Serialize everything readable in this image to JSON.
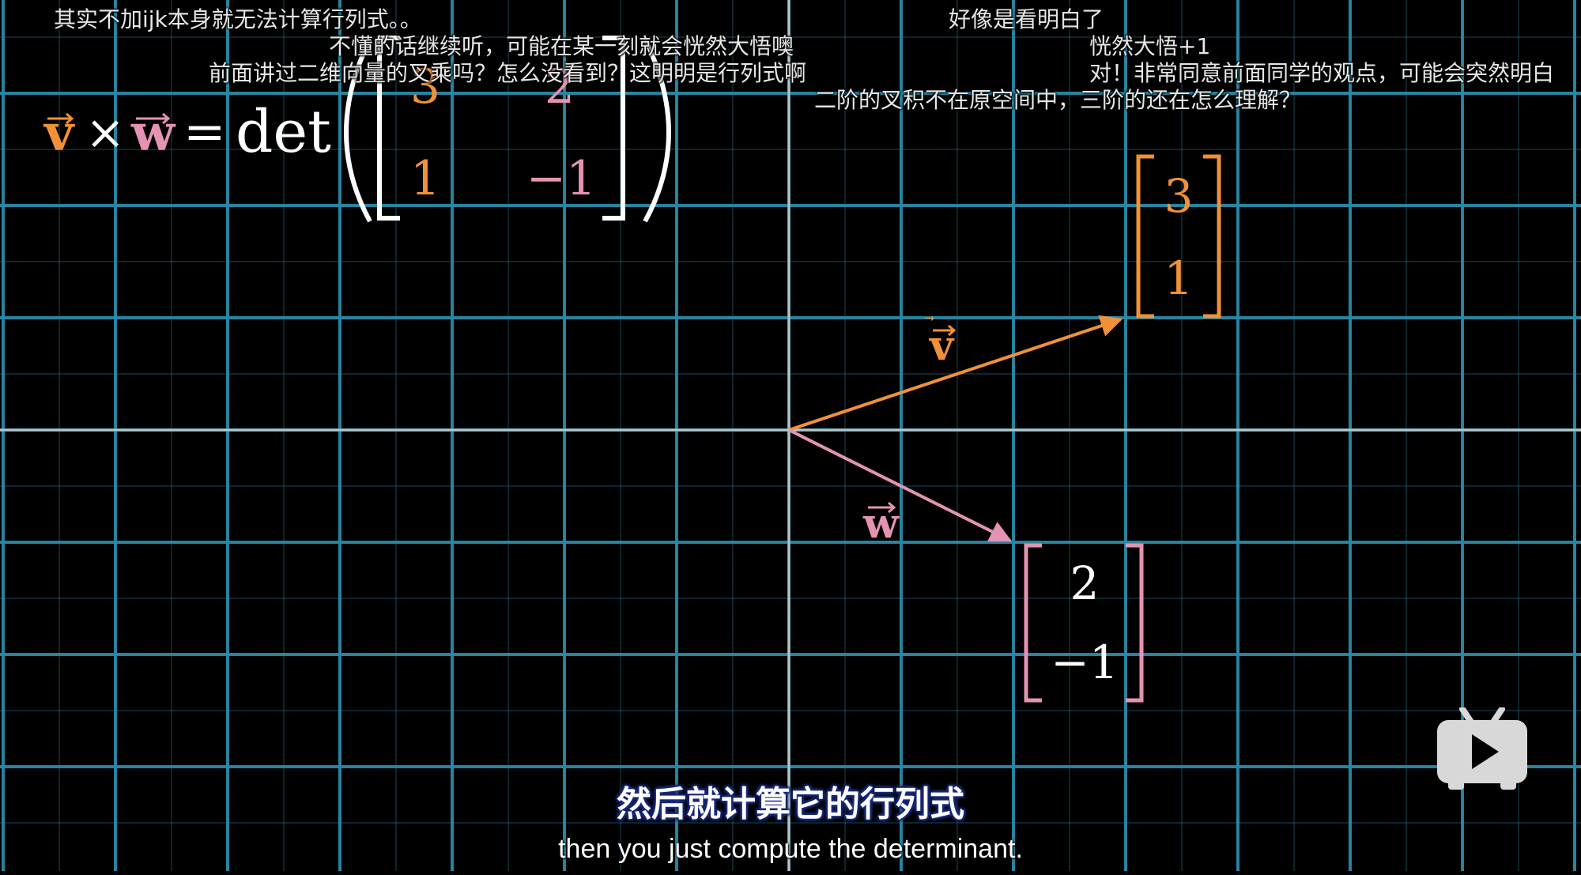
{
  "danmaku": [
    {
      "id": "d0",
      "text": "其实不加ijk本身就无法计算行列式。。"
    },
    {
      "id": "d1",
      "text": "好像是看明白了"
    },
    {
      "id": "d2",
      "text": "不懂的话继续听，可能在某一刻就会恍然大悟噢"
    },
    {
      "id": "d3",
      "text": "恍然大悟+1"
    },
    {
      "id": "d4",
      "text": "前面讲过二维向量的叉乘吗？怎么没看到？这明明是行列式啊"
    },
    {
      "id": "d5",
      "text": "对！非常同意前面同学的观点，可能会突然明白"
    },
    {
      "id": "d6",
      "text": "二阶的叉积不在原空间中，三阶的还在怎么理解？"
    }
  ],
  "formula": {
    "v_label": "v",
    "times": "×",
    "w_label": "w",
    "equals": "=",
    "det": "det",
    "m11": "3",
    "m12": "2",
    "m21": "1",
    "m22": "−1"
  },
  "vector_v": {
    "label": "v",
    "x": 3,
    "y": 1,
    "entries": [
      "3",
      "1"
    ],
    "color": "#f0913a"
  },
  "vector_w": {
    "label": "w",
    "x": 2,
    "y": -1,
    "entries": [
      "2",
      "−1"
    ],
    "color": "#e593b4"
  },
  "colors": {
    "background": "#000000",
    "grid": "#2a8aa6",
    "axis": "#cfcfcf",
    "subtitle_outline": "#1a2b7a"
  },
  "subtitle": {
    "chinese": "然后就计算它的行列式",
    "english": "then you just compute the determinant."
  },
  "player": {
    "play_icon": "play-icon"
  }
}
